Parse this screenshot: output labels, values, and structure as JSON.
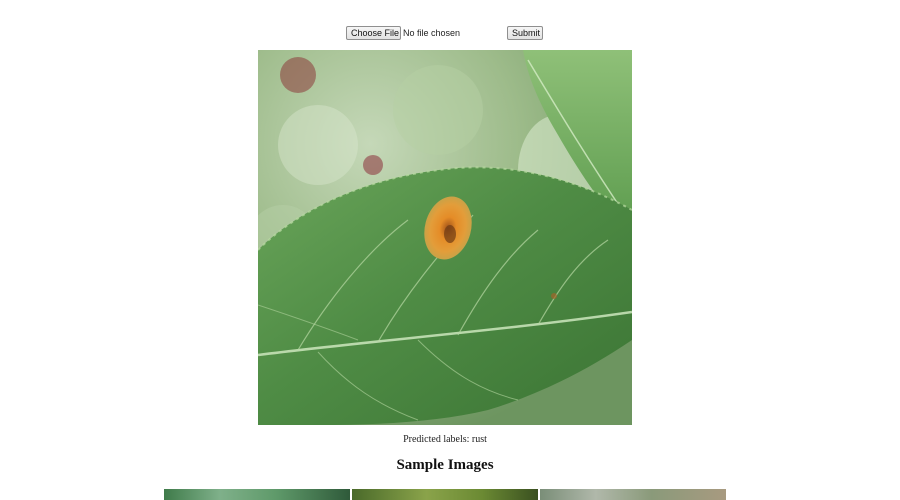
{
  "upload": {
    "choose_file_label": "Choose File",
    "file_status": "No file chosen",
    "submit_label": "Submit"
  },
  "result": {
    "prediction_text": "Predicted labels: rust"
  },
  "samples": {
    "title": "Sample Images"
  }
}
